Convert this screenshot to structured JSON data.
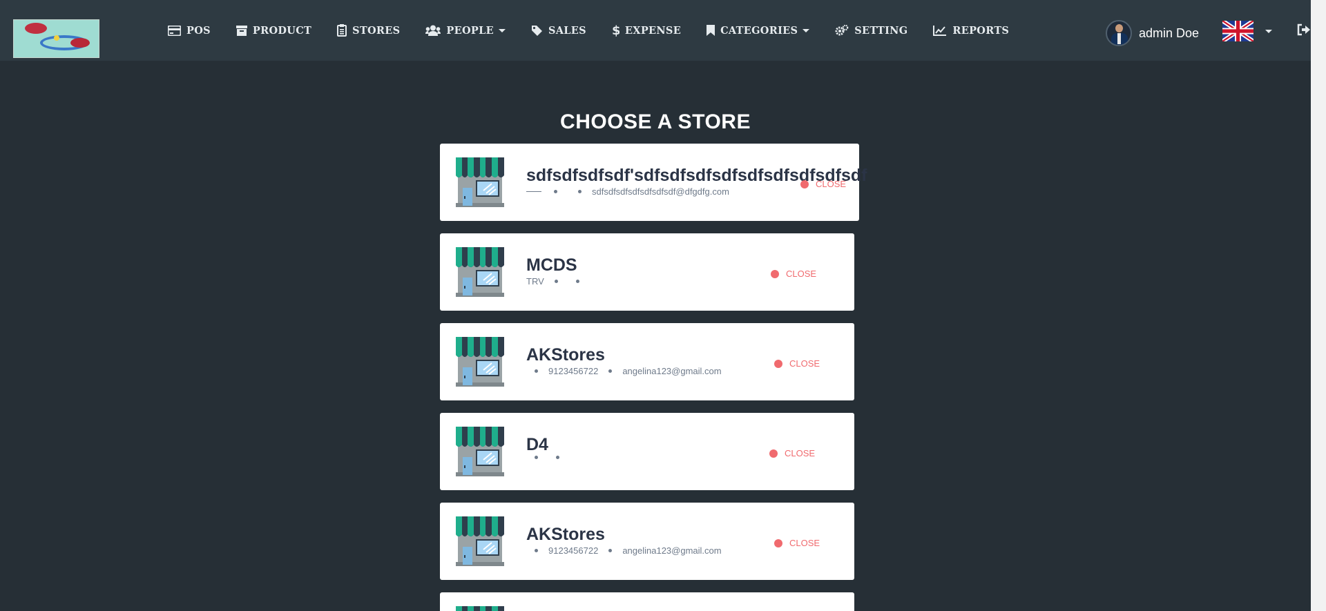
{
  "nav": {
    "items": [
      {
        "label": "POS",
        "icon": "credit-card-icon"
      },
      {
        "label": "PRODUCT",
        "icon": "archive-icon"
      },
      {
        "label": "STORES",
        "icon": "clipboard-icon"
      },
      {
        "label": "PEOPLE",
        "icon": "users-icon"
      },
      {
        "label": "SALES",
        "icon": "tag-icon"
      },
      {
        "label": "EXPENSE",
        "icon": "dollar-icon"
      },
      {
        "label": "CATEGORIES",
        "icon": "bookmark-icon"
      },
      {
        "label": "SETTING",
        "icon": "cogs-icon"
      },
      {
        "label": "REPORTS",
        "icon": "line-chart-icon"
      }
    ]
  },
  "user": {
    "name": "admin Doe"
  },
  "page": {
    "title": "CHOOSE A STORE"
  },
  "stores": [
    {
      "name": "sdfsdfsdfsdf'sdfsdfsdfsdfsdfsdfsdfsdfsdf",
      "city": "",
      "phone": "",
      "email": "sdfsdfsdfsdfsdfsdfsdf@dfgdfg.com",
      "status": "CLOSE"
    },
    {
      "name": "MCDS",
      "city": "TRV",
      "phone": "",
      "email": "",
      "status": "CLOSE"
    },
    {
      "name": "AKStores",
      "city": "",
      "phone": "9123456722",
      "email": "angelina123@gmail.com",
      "status": "CLOSE"
    },
    {
      "name": "D4",
      "city": "",
      "phone": "",
      "email": "",
      "status": "CLOSE"
    },
    {
      "name": "AKStores",
      "city": "",
      "phone": "9123456722",
      "email": "angelina123@gmail.com",
      "status": "CLOSE"
    }
  ],
  "colors": {
    "accent_status": "#f06a6e",
    "background": "#262f36",
    "topbar": "#2e3a42"
  }
}
